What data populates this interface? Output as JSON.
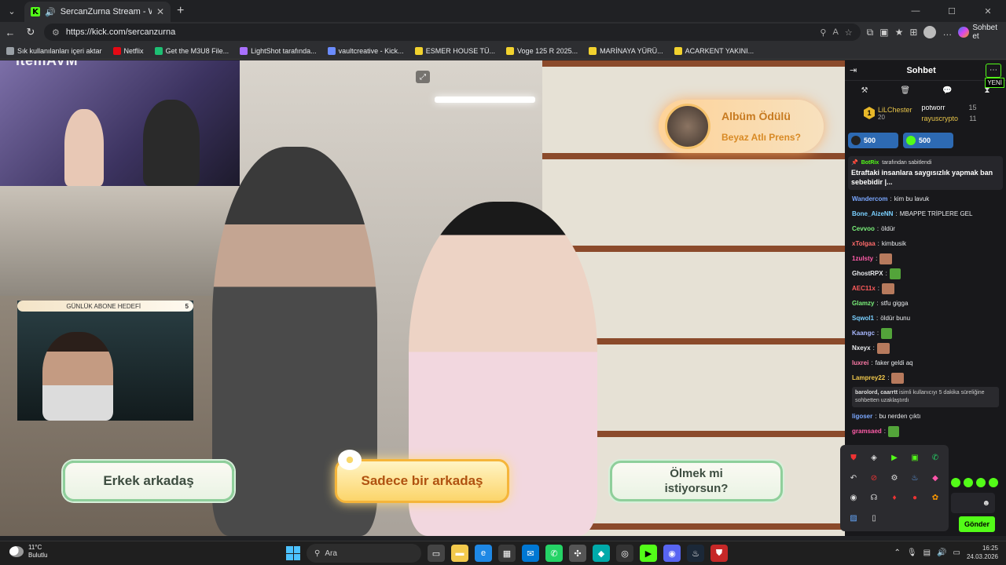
{
  "browser": {
    "tab_title": "SercanZurna Stream - Watch",
    "url": "https://kick.com/sercanzurna",
    "copilot_label": "Sohbet et",
    "bookmarks": [
      {
        "label": "Sık kullanılanları içeri aktar",
        "color": "#9aa0a6"
      },
      {
        "label": "Netflix",
        "color": "#e50914"
      },
      {
        "label": "Get the M3U8 File...",
        "color": "#1dbf73"
      },
      {
        "label": "LightShot tarafında...",
        "color": "#a970ff"
      },
      {
        "label": "vaultcreative - Kick...",
        "color": "#6b8cff"
      },
      {
        "label": "ESMER HOUSE TÜ...",
        "color": "#f2d22e"
      },
      {
        "label": "Voge 125 R 2025...",
        "color": "#f2d22e"
      },
      {
        "label": "MARİNAYA YÜRÜ...",
        "color": "#f2d22e"
      },
      {
        "label": "ACARKENT YAKINI...",
        "color": "#f2d22e"
      }
    ]
  },
  "overlay": {
    "brand": "itemAVM",
    "sub_goal_label": "GÜNLÜK ABONE HEDEFİ",
    "sub_goal_count": "5",
    "reward_title": "Albüm Ödülü",
    "reward_subtitle": "Beyaz Atlı Prens?",
    "choices": {
      "a": "Erkek arkadaş",
      "b": "Sadece bir arkadaş",
      "c_line1": "Ölmek mi",
      "c_line2": "istiyorsun?"
    }
  },
  "chat": {
    "title": "Sohbet",
    "new_label": "YENİ",
    "top_gifter": {
      "rank": "1",
      "name": "LiLChester",
      "count": "20"
    },
    "leaders": [
      {
        "name": "potworr",
        "count": "15"
      },
      {
        "name": "rayuscrypto",
        "count": "11"
      }
    ],
    "pills": [
      "500",
      "500"
    ],
    "pinned": {
      "by": "BotRix",
      "by_suffix": "tarafından sabitlendi",
      "message": "Etraftaki insanlara saygısızlık yapmak ban sebebidir",
      "trail": "|..."
    },
    "messages": [
      {
        "user": "Wandercom",
        "text": "kim bu lavuk",
        "color": "#7aa7ff"
      },
      {
        "user": "Bone_AizeNN",
        "text": "MBAPPE TRİPLERE GEL",
        "color": "#7ad0ff"
      },
      {
        "user": "Cevvoo",
        "text": "öldür",
        "color": "#7af07a"
      },
      {
        "user": "xTolgaa",
        "text": "kimbusik",
        "color": "#ff6b6b"
      },
      {
        "user": "1zulsty",
        "text": "",
        "color": "#ff5ca8"
      },
      {
        "user": "GhostRPX",
        "text": "",
        "color": "#e8eaed"
      },
      {
        "user": "AEC11x",
        "text": "",
        "color": "#ff5c5c"
      },
      {
        "user": "Glamzy",
        "text": "stfu gigga",
        "color": "#7af07a"
      },
      {
        "user": "Sqwol1",
        "text": "öldür bunu",
        "color": "#7ad0ff"
      },
      {
        "user": "Kaangc",
        "text": "",
        "color": "#a8b8ff"
      },
      {
        "user": "Nxeyx",
        "text": "",
        "color": "#e8eaed"
      },
      {
        "user": "luxrei",
        "text": "faker geldi aq",
        "color": "#ff7aa8"
      },
      {
        "user": "Lamprey22",
        "text": "",
        "color": "#f2c94c"
      }
    ],
    "system_message": {
      "users": "barolord, caarrtt",
      "text": "isimli kullanıcıyı 5 dakika süreliğine sohbetten uzaklaştırdı"
    },
    "messages_after": [
      {
        "user": "ligoser",
        "text": "bu nerden çıktı",
        "color": "#7aa7ff"
      },
      {
        "user": "gramsaed",
        "text": "",
        "color": "#ff5ca8"
      }
    ],
    "send_label": "Gönder"
  },
  "taskbar": {
    "temperature": "11°C",
    "weather": "Bulutlu",
    "search_label": "Ara",
    "time": "16:25",
    "date": "24.03.2026"
  }
}
